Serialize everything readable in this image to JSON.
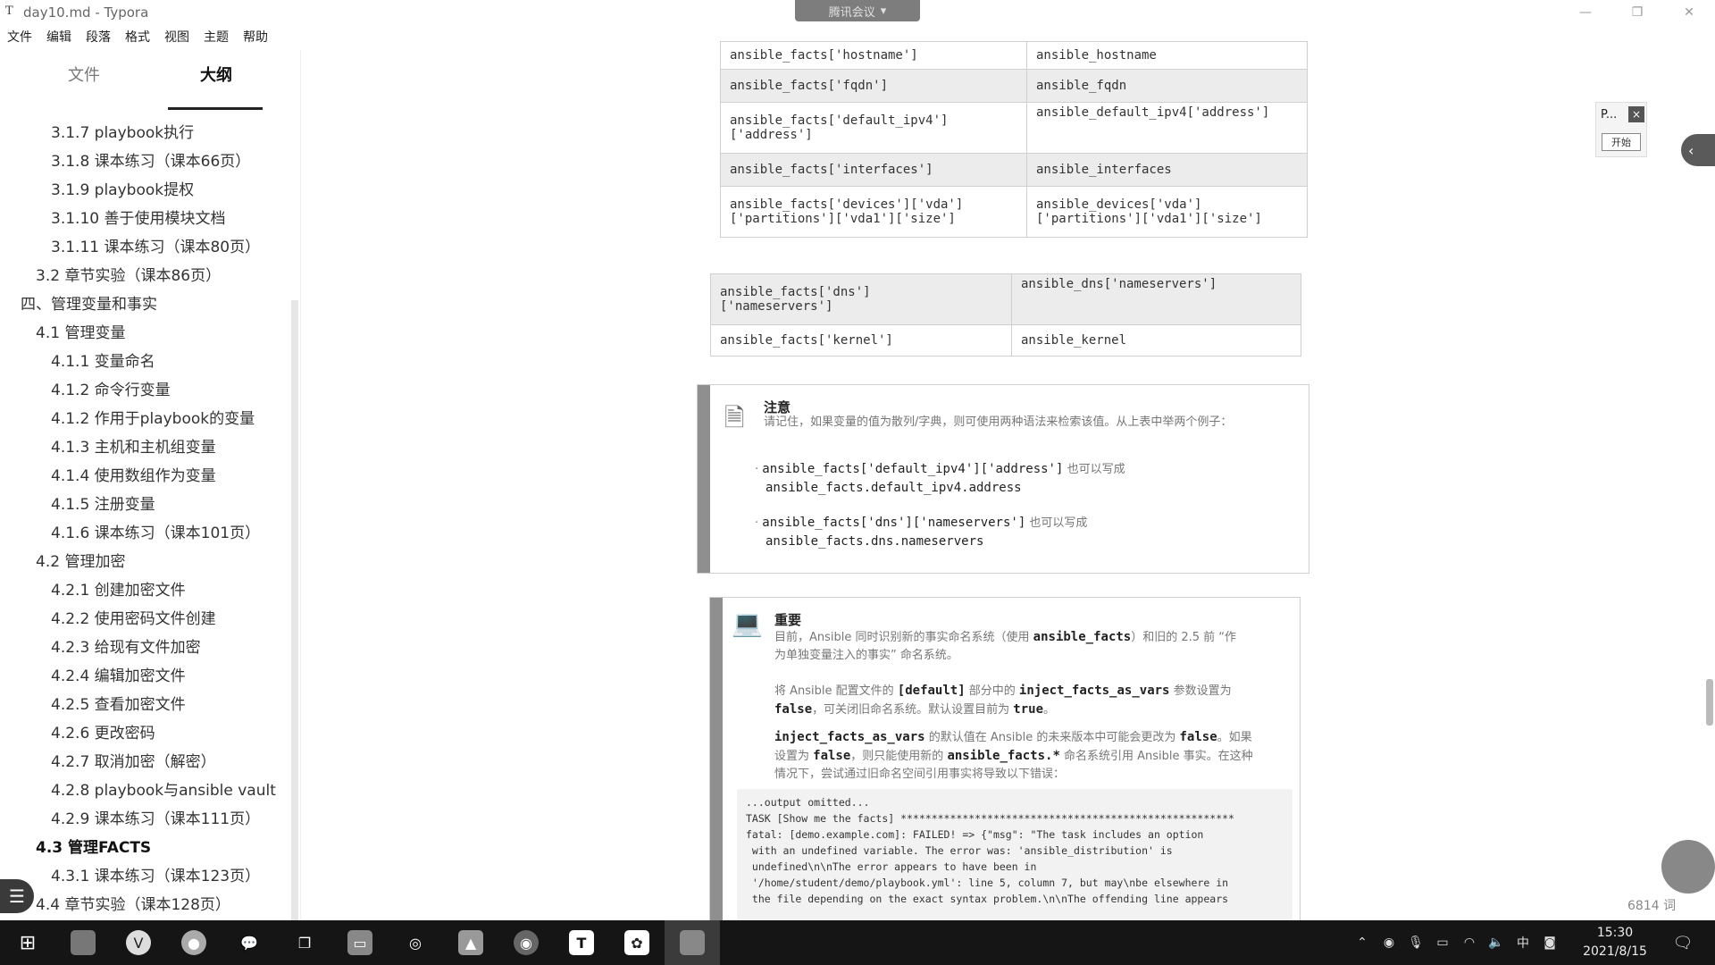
{
  "window": {
    "app_icon": "T",
    "title": "day10.md - Typora",
    "meeting_label": "腾讯会议",
    "controls": [
      "—",
      "❐",
      "✕"
    ]
  },
  "menu": [
    "文件",
    "编辑",
    "段落",
    "格式",
    "视图",
    "主题",
    "帮助"
  ],
  "sidebar": {
    "tab_files": "文件",
    "tab_outline": "大纲",
    "items": [
      {
        "level": 3,
        "label": "3.1.7 playbook执行"
      },
      {
        "level": 3,
        "label": "3.1.8 课本练习（课本66页）"
      },
      {
        "level": 3,
        "label": "3.1.9 playbook提权"
      },
      {
        "level": 3,
        "label": "3.1.10 善于使用模块文档"
      },
      {
        "level": 3,
        "label": "3.1.11 课本练习（课本80页）"
      },
      {
        "level": 2,
        "label": "3.2 章节实验（课本86页）"
      },
      {
        "level": 1,
        "label": "四、管理变量和事实"
      },
      {
        "level": 2,
        "label": "4.1 管理变量"
      },
      {
        "level": 3,
        "label": "4.1.1 变量命名"
      },
      {
        "level": 3,
        "label": "4.1.2 命令行变量"
      },
      {
        "level": 3,
        "label": "4.1.2 作用于playbook的变量"
      },
      {
        "level": 3,
        "label": "4.1.3 主机和主机组变量"
      },
      {
        "level": 3,
        "label": "4.1.4 使用数组作为变量"
      },
      {
        "level": 3,
        "label": "4.1.5 注册变量"
      },
      {
        "level": 3,
        "label": "4.1.6 课本练习（课本101页）"
      },
      {
        "level": 2,
        "label": "4.2 管理加密"
      },
      {
        "level": 3,
        "label": "4.2.1 创建加密文件"
      },
      {
        "level": 3,
        "label": "4.2.2 使用密码文件创建"
      },
      {
        "level": 3,
        "label": "4.2.3 给现有文件加密"
      },
      {
        "level": 3,
        "label": "4.2.4 编辑加密文件"
      },
      {
        "level": 3,
        "label": "4.2.5 查看加密文件"
      },
      {
        "level": 3,
        "label": "4.2.6 更改密码"
      },
      {
        "level": 3,
        "label": "4.2.7 取消加密（解密）"
      },
      {
        "level": 3,
        "label": "4.2.8 playbook与ansible vault"
      },
      {
        "level": 3,
        "label": "4.2.9 课本练习（课本111页）"
      },
      {
        "level": 2,
        "label": "4.3 管理FACTS",
        "active": true
      },
      {
        "level": 3,
        "label": "4.3.1 课本练习（课本123页）"
      },
      {
        "level": 2,
        "label": "4.4 章节实验（课本128页）"
      }
    ],
    "footer_left": "<",
    "footer_code": "</>"
  },
  "table1": [
    [
      "ansible_facts['hostname']",
      "ansible_hostname"
    ],
    [
      "ansible_facts['fqdn']",
      "ansible_fqdn"
    ],
    [
      "ansible_facts['default_ipv4']\n['address']",
      "ansible_default_ipv4['address']"
    ],
    [
      "ansible_facts['interfaces']",
      "ansible_interfaces"
    ],
    [
      "ansible_facts['devices']['vda']\n['partitions']['vda1']['size']",
      "ansible_devices['vda']\n['partitions']['vda1']['size']"
    ]
  ],
  "table2": [
    [
      "ansible_facts['dns']\n['nameservers']",
      "ansible_dns['nameservers']"
    ],
    [
      "ansible_facts['kernel']",
      "ansible_kernel"
    ]
  ],
  "note": {
    "heading": "注意",
    "text": "请记住，如果变量的值为散列/字典，则可使用两种语法来检索该值。从上表中举两个例子：",
    "ex1_code": "ansible_facts['default_ipv4']['address']",
    "ex1_suffix": "也可以写成",
    "ex1_alt": "ansible_facts.default_ipv4.address",
    "ex2_code": "ansible_facts['dns']['nameservers']",
    "ex2_suffix": "也可以写成",
    "ex2_alt": "ansible_facts.dns.nameservers"
  },
  "important": {
    "heading": "重要",
    "p1_a": "目前，Ansible 同时识别新的事实命名系统（使用 ",
    "p1_code": "ansible_facts",
    "p1_b": "）和旧的 2.5 前 “作为单独变量注入的事实” 命名系统。",
    "p2_a": "将 Ansible 配置文件的 ",
    "p2_code1": "[default]",
    "p2_b": " 部分中的 ",
    "p2_code2": "inject_facts_as_vars",
    "p2_c": " 参数设置为 ",
    "p2_code3": "false",
    "p2_d": "，可关闭旧命名系统。默认设置目前为 ",
    "p2_code4": "true",
    "p2_e": "。",
    "p3_code1": "inject_facts_as_vars",
    "p3_a": " 的默认值在 Ansible 的未来版本中可能会更改为 ",
    "p3_code2": "false",
    "p3_b": "。如果设置为 ",
    "p3_code3": "false",
    "p3_c": "，则只能使用新的 ",
    "p3_code4": "ansible_facts.*",
    "p3_d": " 命名系统引用 Ansible 事实。在这种情况下，尝试通过旧命名空间引用事实将导致以下错误：",
    "code": "...output omitted...\nTASK [Show me the facts] ******************************************************\nfatal: [demo.example.com]: FAILED! => {\"msg\": \"The task includes an option\n with an undefined variable. The error was: 'ansible_distribution' is\n undefined\\n\\nThe error appears to have been in\n '/home/student/demo/playbook.yml': line 5, column 7, but may\\nbe elsewhere in\n the file depending on the exact syntax problem.\\n\\nThe offending line appears"
  },
  "popup": {
    "title": "P...",
    "close": "×",
    "start": "开始"
  },
  "right_tab": "‹",
  "status": {
    "word_count": "6814 词"
  },
  "taskbar": {
    "icons": [
      "windows-start",
      "typora-doc",
      "vivaldi",
      "obs",
      "wechat",
      "task-view",
      "file-explorer",
      "edge",
      "photos",
      "qq-music",
      "typora",
      "baidu-netdisk",
      "typora-active"
    ],
    "tray_ime": "中",
    "time": "15:30",
    "date": "2021/8/15"
  }
}
